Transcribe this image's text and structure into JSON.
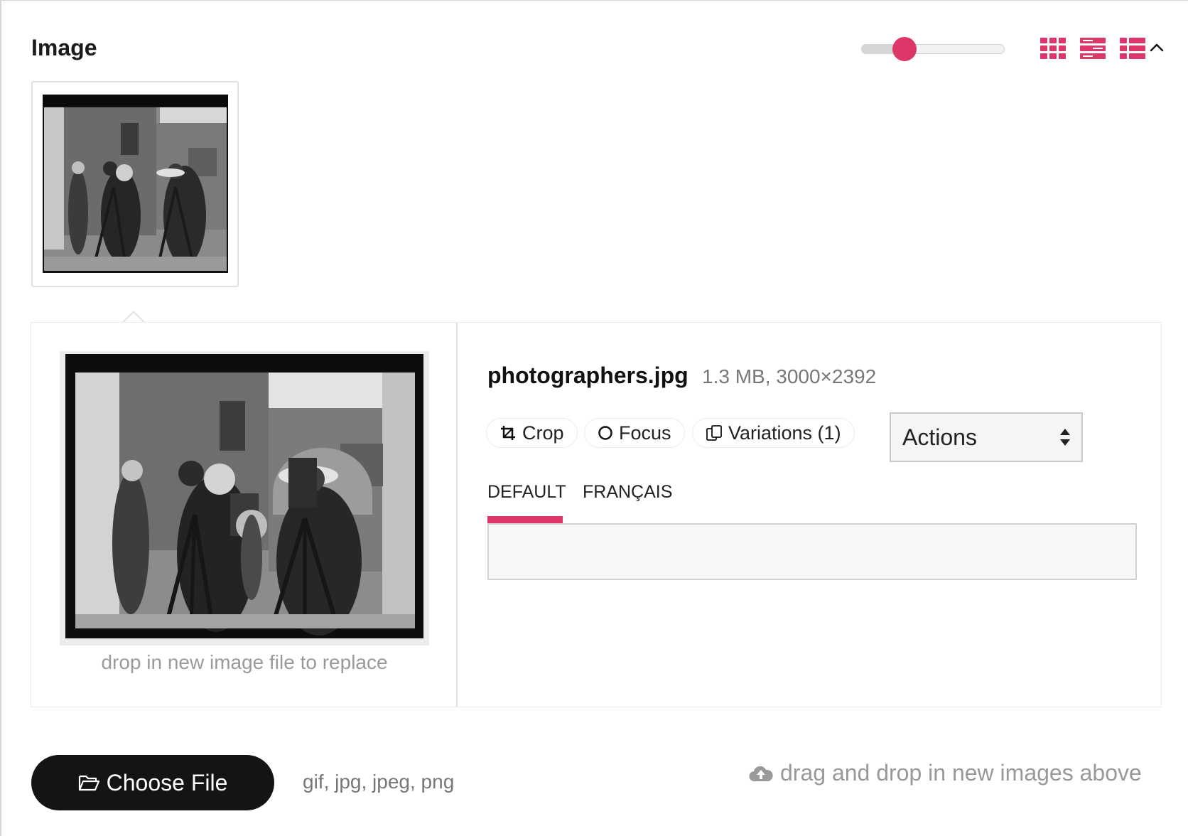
{
  "header": {
    "title": "Image",
    "thumbnail_size_level": 0.3
  },
  "view_modes": [
    "grid-view",
    "compact-list-view",
    "list-view"
  ],
  "thumbnail": {
    "alt": "photographers.jpg"
  },
  "detail": {
    "filename": "photographers.jpg",
    "meta": "1.3 MB, 3000×2392",
    "drop_hint": "drop in new image file to replace",
    "buttons": {
      "crop": "Crop",
      "focus": "Focus",
      "variations": "Variations (1)"
    },
    "actions_select": "Actions",
    "tabs": [
      "DEFAULT",
      "FRANÇAIS"
    ],
    "caption_value": ""
  },
  "footer": {
    "choose_file": "Choose File",
    "file_types": "gif, jpg, jpeg, png",
    "dnd_hint": "drag and drop in new images above"
  },
  "colors": {
    "accent": "#dc3768",
    "button_dark": "#141414"
  }
}
